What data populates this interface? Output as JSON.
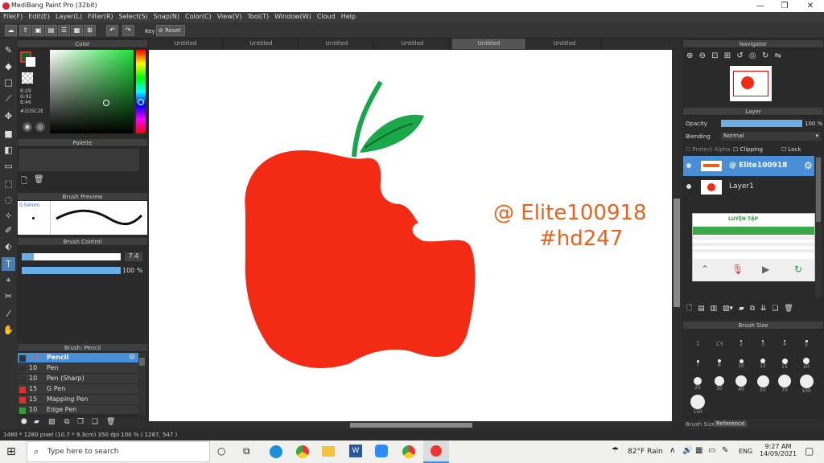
{
  "app": {
    "title": "MediBang Paint Pro (32bit)"
  },
  "menu": [
    "File(F)",
    "Edit(E)",
    "Layer(L)",
    "Filter(R)",
    "Select(S)",
    "Snap(N)",
    "Color(C)",
    "View(V)",
    "Tool(T)",
    "Window(W)",
    "Cloud",
    "Help"
  ],
  "toolbar": {
    "key_label": "Key",
    "reset_label": "Reset"
  },
  "tabs": [
    "Untitled",
    "Untitled",
    "Untitled",
    "Untitled",
    "Untitled",
    "Untitled"
  ],
  "color_panel": {
    "title": "Color",
    "r": "R:29",
    "g": "G:92",
    "b": "B:46",
    "hex": "#1D5C2E"
  },
  "palette_panel": {
    "title": "Palette"
  },
  "brush_preview": {
    "title": "Brush Preview",
    "size": "0.54mm"
  },
  "brush_control": {
    "title": "Brush Control",
    "size": "7.4",
    "opacity": "100 %"
  },
  "brush_list": {
    "title": "Brush: Pencil",
    "items": [
      {
        "size": "7.4",
        "name": "Pencil",
        "color": "#333333"
      },
      {
        "size": "10",
        "name": "Pen",
        "color": "#333333"
      },
      {
        "size": "10",
        "name": "Pen (Sharp)",
        "color": "#333333"
      },
      {
        "size": "15",
        "name": "G Pen",
        "color": "#e03030"
      },
      {
        "size": "15",
        "name": "Mapping Pen",
        "color": "#e03030"
      },
      {
        "size": "10",
        "name": "Edge Pen",
        "color": "#30a030"
      }
    ]
  },
  "canvas_text": {
    "line1": "@ Elite100918",
    "line2": "#hd247",
    "color": "#e8621c"
  },
  "colors": {
    "apple": "#f32a14",
    "leaf": "#1aa84a",
    "stem": "#17a64a"
  },
  "navigator": {
    "title": "Navigator"
  },
  "layer_panel": {
    "title": "Layer",
    "opacity_label": "Opacity",
    "opacity_value": "100 %",
    "blending_label": "Blending",
    "blending_value": "Normal",
    "protect_alpha": "Protect Alpha",
    "clipping": "Clipping",
    "lock": "Lock",
    "layers": [
      "@ Elite100918",
      "Layer1"
    ]
  },
  "brush_size_panel": {
    "title": "Brush Size",
    "sizes": [
      "1",
      "1.5",
      "2",
      "3",
      "4",
      "5",
      "7",
      "8",
      "10",
      "12",
      "15",
      "20",
      "25",
      "30",
      "40",
      "50",
      "70",
      "100",
      "150"
    ]
  },
  "bottom_tabs": [
    "Brush Size",
    "Reference"
  ],
  "status": "1480 * 1280 pixel  (10.7 * 9.3cm)  350 dpi  100 %  ( 1287, 547 )",
  "taskbar": {
    "search_placeholder": "Type here to search",
    "weather": "82°F  Rain",
    "lang": "ENG",
    "time": "9:27 AM",
    "date": "14/09/2021"
  },
  "popup": {
    "heading": "LUYỆN TẬP"
  }
}
